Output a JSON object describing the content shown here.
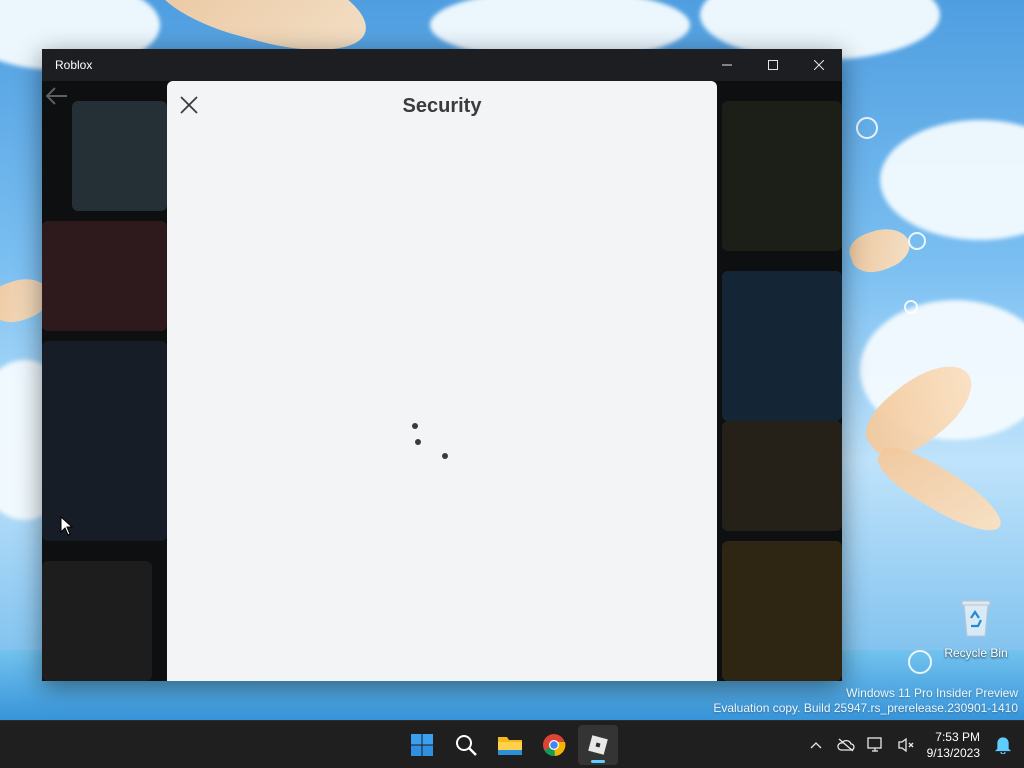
{
  "window": {
    "title": "Roblox",
    "controls": [
      "minimize",
      "maximize",
      "close"
    ]
  },
  "modal": {
    "title": "Security",
    "state": "loading"
  },
  "desktop": {
    "recycle_bin_label": "Recycle Bin",
    "watermark_line1": "Windows 11 Pro Insider Preview",
    "watermark_line2": "Evaluation copy. Build 25947.rs_prerelease.230901-1410"
  },
  "taskbar": {
    "apps": [
      {
        "name": "Start",
        "icon": "windows-logo-icon"
      },
      {
        "name": "Search",
        "icon": "search-icon"
      },
      {
        "name": "File Explorer",
        "icon": "folder-icon"
      },
      {
        "name": "Google Chrome",
        "icon": "chrome-icon"
      },
      {
        "name": "Roblox",
        "icon": "roblox-icon",
        "active": true
      }
    ],
    "time": "7:53 PM",
    "date": "9/13/2023"
  },
  "colors": {
    "accent": "#60cdff",
    "modal_bg": "#f2f4f5",
    "modal_text": "#393b3d"
  }
}
